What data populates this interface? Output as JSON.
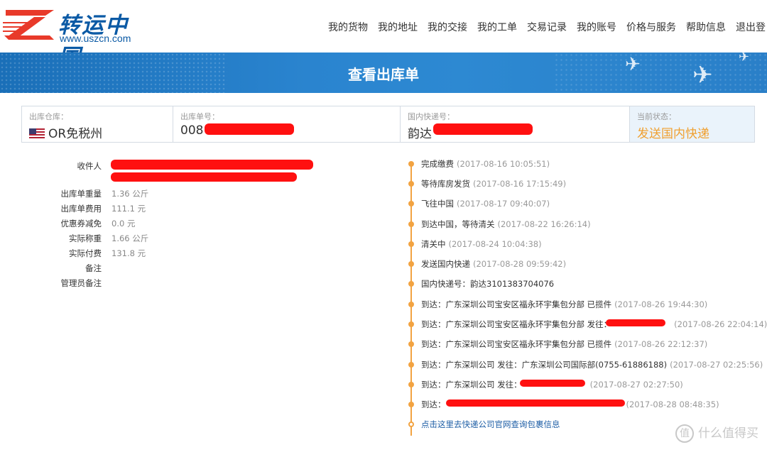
{
  "header": {
    "logo_title": "转运中国",
    "logo_url": "www.uszcn.com",
    "nav": [
      "我的货物",
      "我的地址",
      "我的交接",
      "我的工单",
      "交易记录",
      "我的账号",
      "价格与服务",
      "帮助信息",
      "退出登"
    ]
  },
  "banner": {
    "title": "查看出库单"
  },
  "info": {
    "warehouse_label": "出库仓库：",
    "warehouse_value": "OR免税州",
    "order_label": "出库单号：",
    "order_value": "008",
    "express_label": "国内快递号：",
    "express_value": "韵达",
    "status_label": "当前状态：",
    "status_value": "发送国内快递"
  },
  "details": {
    "recipient_label": "收件人",
    "rows": [
      {
        "k": "出库单重量",
        "v": "1.36 公斤"
      },
      {
        "k": "出库单费用",
        "v": "111.1 元"
      },
      {
        "k": "优惠券减免",
        "v": "0.0 元"
      },
      {
        "k": "实际称重",
        "v": "1.66 公斤"
      },
      {
        "k": "实际付费",
        "v": "131.8 元"
      },
      {
        "k": "备注",
        "v": ""
      },
      {
        "k": "管理员备注",
        "v": ""
      }
    ]
  },
  "timeline": [
    {
      "text": "完成缴费",
      "time": "(2017-08-16 10:05:51)"
    },
    {
      "text": "等待库房发货",
      "time": "(2017-08-16 17:15:49)"
    },
    {
      "text": "飞往中国",
      "time": "(2017-08-17 09:40:07)"
    },
    {
      "text": "到达中国，等待清关",
      "time": "(2017-08-22 16:26:14)"
    },
    {
      "text": "清关中",
      "time": "(2017-08-24 10:04:38)"
    },
    {
      "text": "发送国内快递",
      "time": "(2017-08-28 09:59:42)"
    },
    {
      "text": "国内快递号：韵达3101383704076",
      "time": ""
    },
    {
      "text": "到达：广东深圳公司宝安区福永环宇集包分部 已揽件",
      "time": "(2017-08-26 19:44:30)"
    },
    {
      "text": "到达：广东深圳公司宝安区福永环宇集包分部 发往：",
      "time": "(2017-08-26 22:04:14)"
    },
    {
      "text": "到达：广东深圳公司宝安区福永环宇集包分部 已揽件",
      "time": "(2017-08-26 22:12:37)"
    },
    {
      "text": "到达：广东深圳公司 发往：广东深圳公司国际部(0755-61886188)",
      "time": "(2017-08-27 02:25:56)"
    },
    {
      "text": "到达：广东深圳公司 发往：",
      "time": "(2017-08-27 02:27:50)"
    },
    {
      "text": "到达：",
      "time": "(2017-08-28 08:48:35)"
    }
  ],
  "timeline_link": "点击这里去快递公司官网查询包裹信息",
  "watermark": "什么值得买",
  "colors": {
    "banner": "#2a84cf",
    "accent": "#f2a341",
    "status": "#f0a030"
  }
}
